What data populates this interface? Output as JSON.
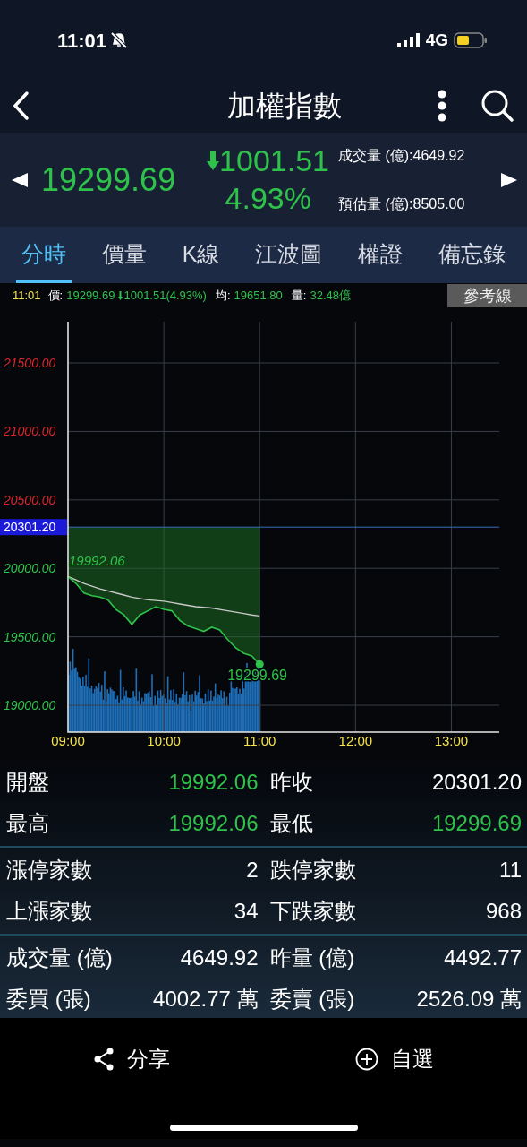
{
  "status_bar": {
    "time": "11:01",
    "network": "4G"
  },
  "nav": {
    "title": "加權指數"
  },
  "quote": {
    "price": "19299.69",
    "change": "1001.51",
    "percent": "4.93%",
    "color": "#2fc24a",
    "volume_label": "成交量 (億):",
    "volume": "4649.92",
    "estimate_label": "預估量 (億):",
    "estimate": "8505.00"
  },
  "tabs": [
    {
      "label": "分時",
      "selected": true
    },
    {
      "label": "價量",
      "selected": false
    },
    {
      "label": "K線",
      "selected": false
    },
    {
      "label": "江波圖",
      "selected": false
    },
    {
      "label": "權證",
      "selected": false
    },
    {
      "label": "備忘錄",
      "selected": false
    }
  ],
  "info_line": {
    "time": "11:01",
    "price_label": "價:",
    "price": "19299.69",
    "change": "1001.51(4.93%)",
    "avg_label": "均:",
    "avg": "19651.80",
    "vol_label": "量:",
    "vol": "32.48億",
    "button": "參考線"
  },
  "chart": {
    "chart_data": {
      "type": "line",
      "categories": [
        "09:00",
        null,
        null,
        null,
        null,
        null,
        null,
        null,
        null,
        null,
        null,
        null,
        "10:00",
        null,
        null,
        null,
        null,
        null,
        null,
        null,
        null,
        null,
        null,
        null,
        "11:00",
        null,
        null,
        null,
        null,
        null,
        null,
        null,
        null,
        null,
        null,
        null,
        "12:00",
        null,
        null,
        null,
        null,
        null,
        null,
        null,
        null,
        null,
        null,
        null,
        "13:00",
        null,
        null,
        null,
        null,
        null,
        null
      ],
      "series": [
        {
          "color": "#2fc24a",
          "values": [
            19940,
            19890,
            19820,
            19800,
            19790,
            19770,
            19700,
            19660,
            19590,
            19660,
            19690,
            19720,
            19700,
            19690,
            19620,
            19580,
            19560,
            19540,
            19570,
            19550,
            19480,
            19420,
            19380,
            19360,
            19300,
            null,
            null,
            null,
            null,
            null,
            null,
            null,
            null,
            null,
            null,
            null,
            null,
            null,
            null,
            null,
            null,
            null,
            null,
            null,
            null,
            null,
            null,
            null,
            null,
            null,
            null,
            null,
            null,
            null,
            null
          ]
        },
        {
          "color": "#c8c8c8",
          "values": [
            19940,
            19915,
            19890,
            19870,
            19850,
            19835,
            19820,
            19805,
            19790,
            19780,
            19770,
            19765,
            19760,
            19750,
            19740,
            19730,
            19720,
            19715,
            19710,
            19700,
            19690,
            19680,
            19670,
            19660,
            19652,
            null,
            null,
            null,
            null,
            null,
            null,
            null,
            null,
            null,
            null,
            null,
            null,
            null,
            null,
            null,
            null,
            null,
            null,
            null,
            null,
            null,
            null,
            null,
            null,
            null,
            null,
            null,
            null,
            null,
            null
          ]
        }
      ],
      "ylim": [
        18804,
        21801
      ],
      "yticks": [
        {
          "value": 19000,
          "label": "19000.00"
        },
        {
          "value": 19500,
          "label": "19500.00"
        },
        {
          "value": 20000,
          "label": "20000.00"
        },
        {
          "value": 20500,
          "label": "20500.00"
        },
        {
          "value": 21000,
          "label": "21000.00"
        },
        {
          "value": 21500,
          "label": "21500.00"
        }
      ],
      "grid": true,
      "ref_lines": [
        {
          "axis": "y",
          "value": 20301.2,
          "label": "20301.20"
        }
      ],
      "annotations": [
        "19992.06",
        "19299.69"
      ]
    }
  },
  "stats": [
    [
      {
        "label": "開盤",
        "value": "19992.06",
        "color": "#2fc24a"
      },
      {
        "label": "昨收",
        "value": "20301.20",
        "color": "#ffffff"
      },
      {
        "label": "最高",
        "value": "19992.06",
        "color": "#2fc24a"
      },
      {
        "label": "最低",
        "value": "19299.69",
        "color": "#2fc24a"
      }
    ],
    [
      {
        "label": "漲停家數",
        "value": "2",
        "color": "#ffffff"
      },
      {
        "label": "跌停家數",
        "value": "11",
        "color": "#ffffff"
      },
      {
        "label": "上漲家數",
        "value": "34",
        "color": "#ffffff"
      },
      {
        "label": "下跌家數",
        "value": "968",
        "color": "#ffffff"
      }
    ],
    [
      {
        "label": "成交量 (億)",
        "value": "4649.92",
        "color": "#ffffff"
      },
      {
        "label": "昨量 (億)",
        "value": "4492.77",
        "color": "#ffffff"
      },
      {
        "label": "委買 (張)",
        "value": "4002.77 萬",
        "color": "#ffffff"
      },
      {
        "label": "委賣 (張)",
        "value": "2526.09 萬",
        "color": "#ffffff"
      }
    ]
  ],
  "bottom_bar": [
    {
      "kind": "share",
      "label": "分享"
    },
    {
      "kind": "add",
      "label": "自選"
    }
  ]
}
